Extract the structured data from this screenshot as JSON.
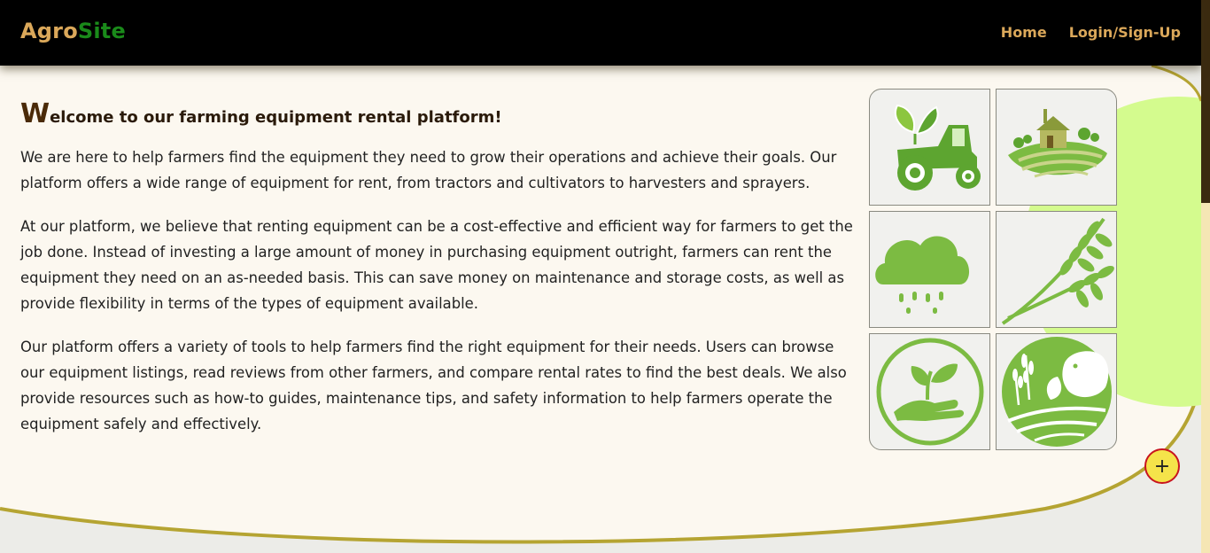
{
  "nav": {
    "logo_part1": "Agro",
    "logo_part2": "Site",
    "links": [
      "Home",
      "Login/Sign-Up"
    ]
  },
  "intro": {
    "heading_initial": "W",
    "heading_rest": "elcome to our farming equipment rental platform!",
    "paragraphs": [
      "We are here to help farmers find the equipment they need to grow their operations and achieve their goals. Our platform offers a wide range of equipment for rent, from tractors and cultivators to harvesters and sprayers.",
      "At our platform, we believe that renting equipment can be a cost-effective and efficient way for farmers to get the job done. Instead of investing a large amount of money in purchasing equipment outright, farmers can rent the equipment they need on an as-needed basis. This can save money on maintenance and storage costs, as well as provide flexibility in terms of the types of equipment available.",
      "Our platform offers a variety of tools to help farmers find the right equipment for their needs. Users can browse our equipment listings, read reviews from other farmers, and compare rental rates to find the best deals. We also provide resources such as how-to guides, maintenance tips, and safety information to help farmers operate the equipment safely and effectively."
    ]
  },
  "icons": [
    "tractor-icon",
    "farm-house-icon",
    "rain-cloud-icon",
    "wheat-icon",
    "plant-in-hand-icon",
    "sheep-farm-icon"
  ],
  "fab": {
    "label": "+"
  },
  "colors": {
    "navbar_bg": "#000000",
    "logo_primary": "#dba85a",
    "logo_accent": "#1a8a1a",
    "content_bg": "#fcf8f0",
    "lime_accent": "#d4fb8e",
    "icon_green": "#7cbb42",
    "fab_fill": "#f5e34a",
    "fab_border": "#c8141e"
  }
}
